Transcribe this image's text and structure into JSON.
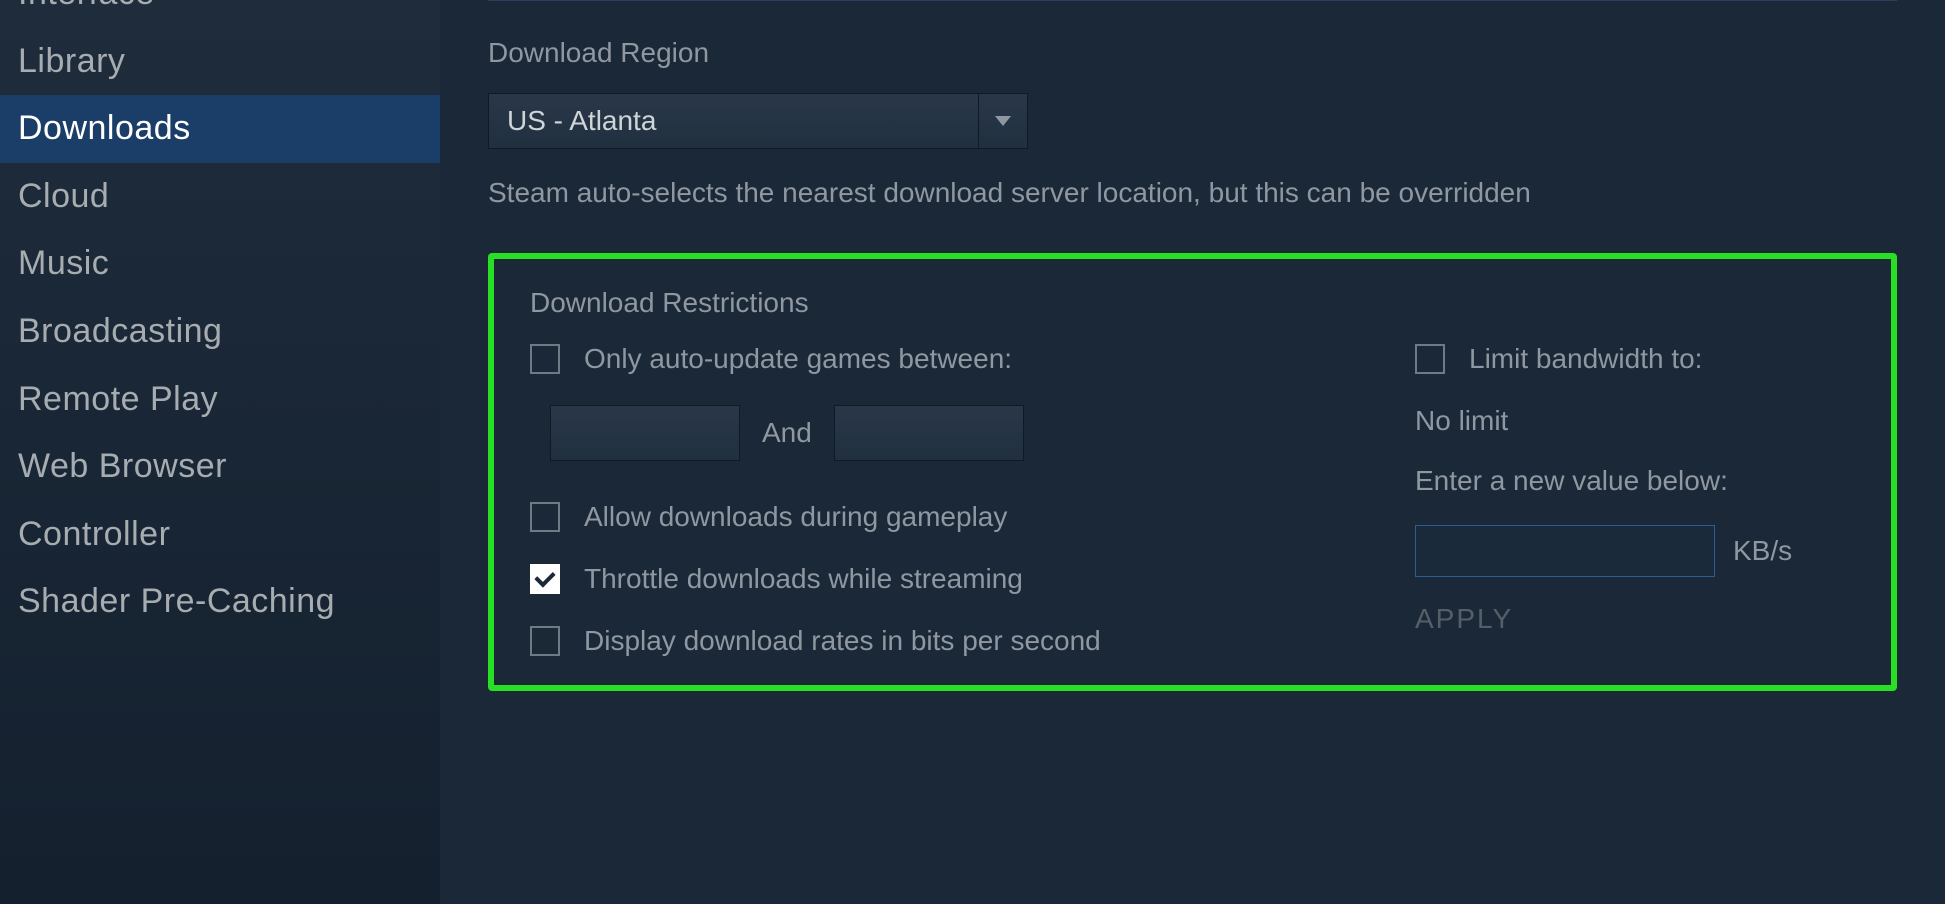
{
  "sidebar": {
    "items": [
      {
        "label": "Interface",
        "active": false,
        "cut": true
      },
      {
        "label": "Library",
        "active": false
      },
      {
        "label": "Downloads",
        "active": true
      },
      {
        "label": "Cloud",
        "active": false
      },
      {
        "label": "Music",
        "active": false
      },
      {
        "label": "Broadcasting",
        "active": false
      },
      {
        "label": "Remote Play",
        "active": false
      },
      {
        "label": "Web Browser",
        "active": false
      },
      {
        "label": "Controller",
        "active": false
      },
      {
        "label": "Shader Pre-Caching",
        "active": false
      }
    ]
  },
  "region": {
    "title": "Download Region",
    "selected": "US - Atlanta",
    "help": "Steam auto-selects the nearest download server location, but this can be overridden"
  },
  "restrictions": {
    "title": "Download Restrictions",
    "auto_update_label": "Only auto-update games between:",
    "and_label": "And",
    "allow_gameplay_label": "Allow downloads during gameplay",
    "throttle_label": "Throttle downloads while streaming",
    "bits_label": "Display download rates in bits per second",
    "limit_label": "Limit bandwidth to:",
    "current_limit": "No limit",
    "enter_new": "Enter a new value below:",
    "unit": "KB/s",
    "apply": "APPLY"
  }
}
